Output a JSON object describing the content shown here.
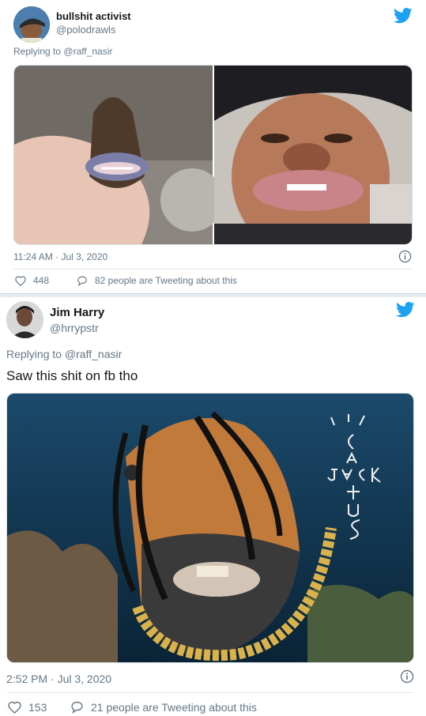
{
  "colors": {
    "twitter_blue": "#1da1f2",
    "secondary_text": "#657786"
  },
  "tweets": [
    {
      "name": "bullshit activist",
      "handle": "@polodrawls",
      "reply_prefix": "Replying to",
      "reply_to": "@raff_nasir",
      "text": "",
      "timestamp": "11:24 AM · Jul 3, 2020",
      "likes": "448",
      "retweets_text": "82 people are Tweeting about this",
      "icons": [
        "twitter-bird-icon",
        "info-icon",
        "heart-icon",
        "speech-bubble-icon"
      ]
    },
    {
      "name": "Jim Harry",
      "handle": "@hrrypstr",
      "reply_prefix": "Replying to",
      "reply_to": "@raff_nasir",
      "text": "Saw this shit on fb tho",
      "timestamp": "2:52 PM · Jul 3, 2020",
      "likes": "153",
      "retweets_text": "21 people are Tweeting about this",
      "icons": [
        "twitter-bird-icon",
        "info-icon",
        "heart-icon",
        "speech-bubble-icon"
      ]
    }
  ]
}
